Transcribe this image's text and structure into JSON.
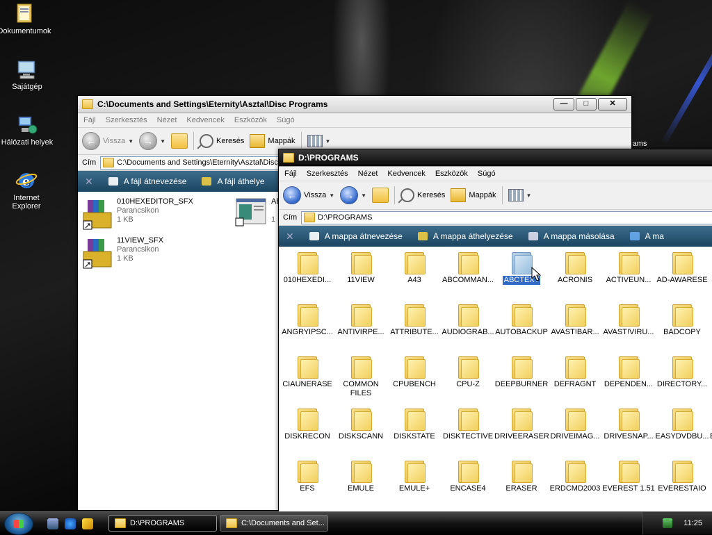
{
  "desktop": {
    "icons": [
      {
        "label": "Dokumentumok",
        "icon": "folder-documents-icon"
      },
      {
        "label": "Sajátgép",
        "icon": "computer-icon"
      },
      {
        "label": "Hálózati helyek",
        "icon": "network-icon"
      },
      {
        "label": "Internet Explorer",
        "icon": "internet-explorer-icon"
      }
    ],
    "partial_text": "rams"
  },
  "back_window": {
    "title": "C:\\Documents and Settings\\Eternity\\Asztal\\Disc Programs",
    "menu": [
      "Fájl",
      "Szerkesztés",
      "Nézet",
      "Kedvencek",
      "Eszközök",
      "Súgó"
    ],
    "back_label": "Vissza",
    "search_label": "Keresés",
    "folders_label": "Mappák",
    "address_label": "Cím",
    "address": "C:\\Documents and Settings\\Eternity\\Asztal\\Disc",
    "tasks": [
      "A fájl átnevezése",
      "A fájl áthelye"
    ],
    "files": [
      {
        "name": "010HEXEDITOR_SFX",
        "type": "Parancsikon",
        "size": "1 KB"
      },
      {
        "name": "11VIEW_SFX",
        "type": "Parancsikon",
        "size": "1 KB"
      }
    ],
    "partial_file": {
      "name": "AB",
      "size": "1"
    }
  },
  "front_window": {
    "title": "D:\\PROGRAMS",
    "menu": [
      "Fájl",
      "Szerkesztés",
      "Nézet",
      "Kedvencek",
      "Eszközök",
      "Súgó"
    ],
    "back_label": "Vissza",
    "search_label": "Keresés",
    "folders_label": "Mappák",
    "address_label": "Cím",
    "address": "D:\\PROGRAMS",
    "tasks": [
      "A mappa átnevezése",
      "A mappa áthelyezése",
      "A mappa másolása",
      "A ma"
    ],
    "folders": [
      "010HEXEDI...",
      "11VIEW",
      "A43",
      "ABCOMMAN...",
      "ABCTEXT",
      "ACRONIS",
      "ACTIVEUN...",
      "AD-AWARESE",
      "ANGRYIPSC...",
      "ANTIVIRPE...",
      "ATTRIBUTE...",
      "AUDIOGRAB...",
      "AUTOBACKUP",
      "AVAST!BAR...",
      "AVAST!VIRU...",
      "BADCOPY",
      "CIAUNERASE",
      "COMMON FILES",
      "CPUBENCH",
      "CPU-Z",
      "DEEPBURNER",
      "DEFRAGNT",
      "DEPENDEN...",
      "DIRECTORY...",
      "DISKRECON",
      "DISKSCANN",
      "DISKSTATE",
      "DISKTECTIVE",
      "DRIVEERASER",
      "DRIVEIMAG...",
      "DRIVESNAP...",
      "EASYDVDBU...",
      "EFS",
      "EMULE",
      "EMULE+",
      "ENCASE4",
      "ERASER",
      "ERDCMD2003",
      "EVEREST 1.51",
      "EVERESTAIO"
    ],
    "selected_folder": "ABCTEXT",
    "partial_right_letter": "E"
  },
  "taskbar": {
    "buttons": [
      "D:\\PROGRAMS",
      "C:\\Documents and Set..."
    ],
    "clock": "11:25"
  }
}
